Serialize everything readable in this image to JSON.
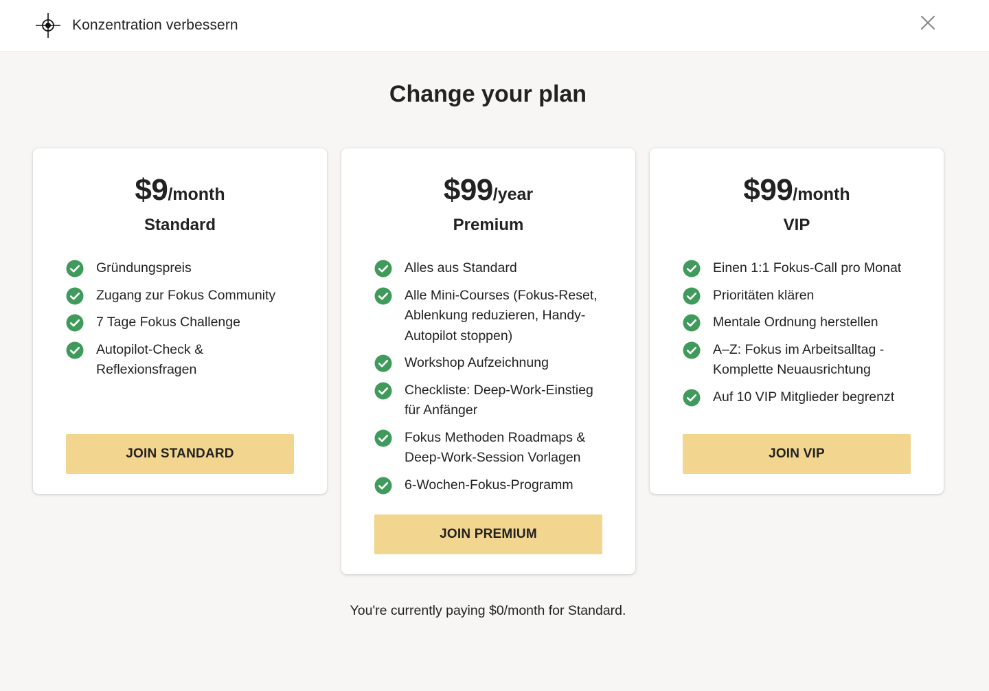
{
  "header": {
    "title": "Konzentration verbessern",
    "logo_icon": "crosshair-icon",
    "close_icon": "close-icon"
  },
  "heading": "Change your plan",
  "colors": {
    "button_bg": "#f2d58e",
    "check_green": "#3f9a5c",
    "background": "#f7f6f4"
  },
  "plans": [
    {
      "price": "$9",
      "period": "/month",
      "name": "Standard",
      "features": [
        "Gründungspreis",
        "Zugang zur Fokus Community",
        "7 Tage Fokus Challenge",
        "Autopilot-Check & Reflexionsfragen"
      ],
      "button_label": "JOIN STANDARD"
    },
    {
      "price": "$99",
      "period": "/year",
      "name": "Premium",
      "features": [
        "Alles aus Standard",
        "Alle Mini-Courses (Fokus-Reset, Ablenkung reduzieren, Handy-Autopilot stoppen)",
        "Workshop Aufzeichnung",
        "Checkliste: Deep-Work-Einstieg für Anfänger",
        "Fokus Methoden Roadmaps & Deep-Work-Session Vorlagen",
        "6-Wochen-Fokus-Programm"
      ],
      "button_label": "JOIN PREMIUM"
    },
    {
      "price": "$99",
      "period": "/month",
      "name": "VIP",
      "features": [
        "Einen 1:1 Fokus-Call pro Monat",
        "Prioritäten klären",
        "Mentale Ordnung herstellen",
        "A–Z: Fokus im Arbeitsalltag - Komplette Neuausrichtung",
        "Auf 10 VIP Mitglieder begrenzt"
      ],
      "button_label": "JOIN VIP"
    }
  ],
  "footer_note": "You're currently paying $0/month for Standard."
}
